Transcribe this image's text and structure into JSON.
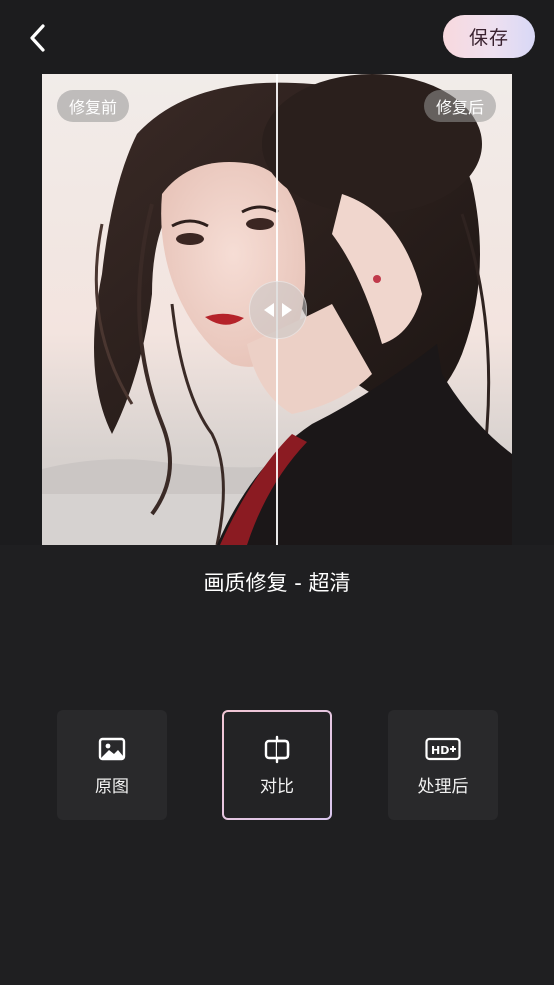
{
  "header": {
    "back_icon": "chevron-left-icon",
    "save_label": "保存"
  },
  "preview": {
    "before_label": "修复前",
    "after_label": "修复后",
    "compare_position": 0.5
  },
  "panel": {
    "mode_title": "画质修复 - 超清",
    "options": [
      {
        "label": "原图",
        "icon": "image-icon",
        "selected": false
      },
      {
        "label": "对比",
        "icon": "compare-split-icon",
        "selected": true
      },
      {
        "label": "处理后",
        "icon": "hd-plus-icon",
        "selected": false
      }
    ]
  },
  "colors": {
    "background": "#1f1f21",
    "save_gradient_start": "#f8d9de",
    "save_gradient_end": "#d8d8f6",
    "selected_border_start": "#f2c6d4",
    "selected_border_end": "#d9c6ee"
  }
}
